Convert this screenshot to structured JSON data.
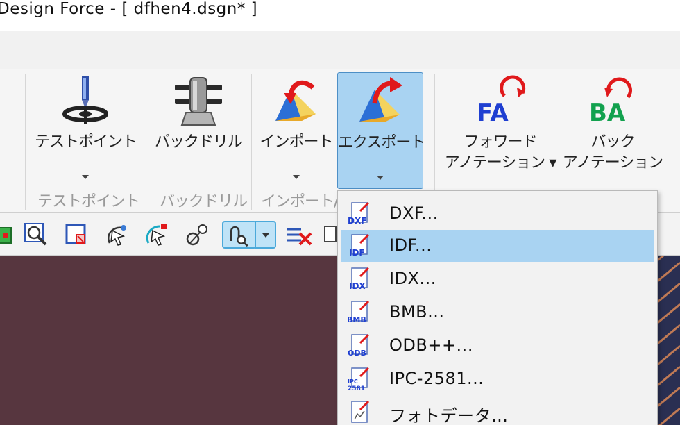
{
  "window": {
    "title": "Design Force - [ dfhen4.dsgn* ]"
  },
  "ribbon": {
    "buttons": [
      {
        "label": "テストポイント",
        "label2": "",
        "icon": "test-point-probe-icon",
        "dropdown": true
      },
      {
        "label": "バックドリル",
        "label2": "",
        "icon": "back-drill-icon",
        "dropdown": false
      },
      {
        "label": "インポート",
        "label2": "",
        "icon": "import-icon",
        "dropdown": true
      },
      {
        "label": "エクスポート",
        "label2": "",
        "icon": "export-icon",
        "dropdown": true,
        "active": true
      },
      {
        "label": "フォワード",
        "label2": "アノテーション ▾",
        "icon": "forward-annotation-icon",
        "icon_text": "FA"
      },
      {
        "label": "バック",
        "label2": "アノテーション",
        "icon": "back-annotation-icon",
        "icon_text": "BA"
      }
    ],
    "groups": [
      "テストポイント",
      "バックドリル",
      "インポート/"
    ],
    "colors": {
      "fa_blue": "#1f3fd1",
      "ba_green": "#12a14e",
      "accent_red": "#e0191b",
      "active_bg": "#a9d3f2"
    }
  },
  "toolbar": {
    "icons": [
      "grid-select-icon",
      "zoom-window-icon",
      "zoom-select-icon",
      "select-net-icon",
      "select-component-icon",
      "pick-icon",
      "route-tool-icon",
      "route-tool-dropdown-icon",
      "fanout-delete-icon",
      "misc-tool-icon"
    ]
  },
  "export_menu": {
    "items": [
      {
        "label": "DXF...",
        "icon": "dxf-file-icon",
        "icon_text": "DXF"
      },
      {
        "label": "IDF...",
        "icon": "idf-file-icon",
        "icon_text": "IDF",
        "highlighted": true
      },
      {
        "label": "IDX...",
        "icon": "idx-file-icon",
        "icon_text": "IDX"
      },
      {
        "label": "BMB...",
        "icon": "bmb-file-icon",
        "icon_text": "BMB"
      },
      {
        "label": "ODB++...",
        "icon": "odb-file-icon",
        "icon_text": "ODB"
      },
      {
        "label": "IPC-2581...",
        "icon": "ipc-2581-file-icon",
        "icon_text": "IPC 2581"
      },
      {
        "label": "フォトデータ...",
        "icon": "photo-data-file-icon",
        "icon_text": ""
      }
    ]
  }
}
